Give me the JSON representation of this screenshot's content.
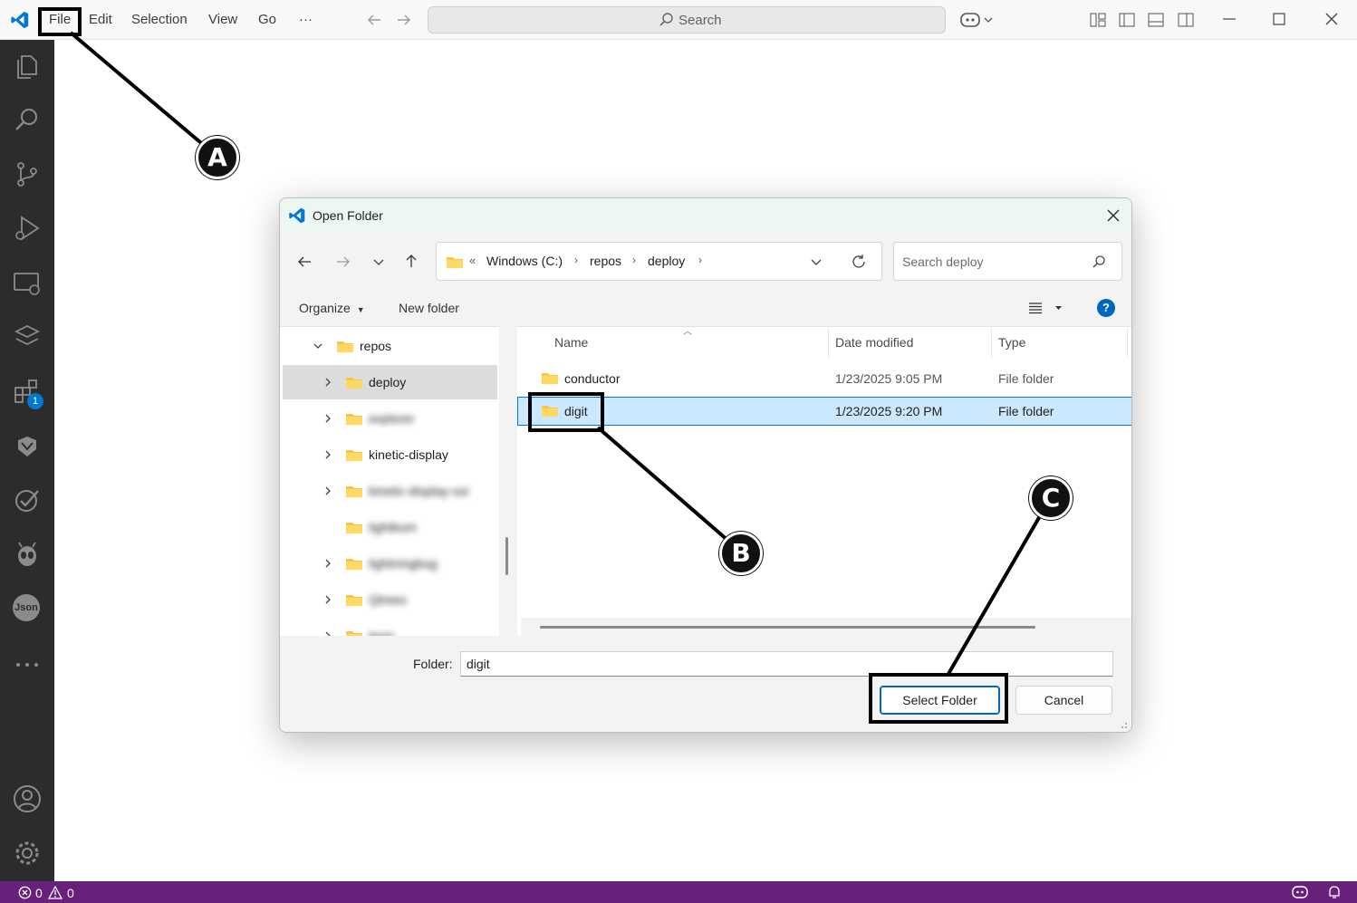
{
  "titlebar": {
    "menu": [
      "File",
      "Edit",
      "Selection",
      "View",
      "Go",
      "···"
    ],
    "search_label": "Search"
  },
  "activity_bar": {
    "icons": [
      "explorer-icon",
      "search-icon",
      "source-control-icon",
      "run-debug-icon",
      "remote-explorer-icon",
      "deployments-icon",
      "extensions-icon",
      "ml-icon",
      "testing-icon",
      "alien-icon",
      "json-icon",
      "more-icon",
      "account-icon",
      "settings-icon"
    ],
    "extensions_badge": "1",
    "json_label": "Json"
  },
  "status_bar": {
    "errors": "0",
    "warnings": "0"
  },
  "dialog": {
    "title": "Open Folder",
    "breadcrumb": {
      "overflow": "«",
      "parts": [
        "Windows (C:)",
        "repos",
        "deploy"
      ]
    },
    "search_placeholder": "Search deploy",
    "toolbar": {
      "organize": "Organize",
      "new_folder": "New folder"
    },
    "nav_tree": [
      {
        "label": "repos",
        "expanded": true
      },
      {
        "label": "deploy",
        "selected": true
      },
      {
        "label": "explorer",
        "blurred": true
      },
      {
        "label": "kinetic-display"
      },
      {
        "label": "kinetic-display-ssr",
        "blurred": true
      },
      {
        "label": "lightbum",
        "blurred": true
      },
      {
        "label": "lightningbug",
        "blurred": true
      },
      {
        "label": "Qtrees",
        "blurred": true
      },
      {
        "label": "term",
        "blurred": true
      }
    ],
    "columns": {
      "name": "Name",
      "date": "Date modified",
      "type": "Type"
    },
    "files": [
      {
        "name": "conductor",
        "date": "1/23/2025 9:05 PM",
        "type": "File folder"
      },
      {
        "name": "digit",
        "date": "1/23/2025 9:20 PM",
        "type": "File folder",
        "selected": true
      }
    ],
    "folder_label": "Folder:",
    "folder_value": "digit",
    "select_button": "Select Folder",
    "cancel_button": "Cancel"
  },
  "annotations": {
    "a": "A",
    "b": "B",
    "c": "C"
  },
  "colors": {
    "accent": "#0067c0",
    "statusbar": "#68217a",
    "activitybar": "#2c2c2c",
    "selection": "#cce8ff"
  }
}
